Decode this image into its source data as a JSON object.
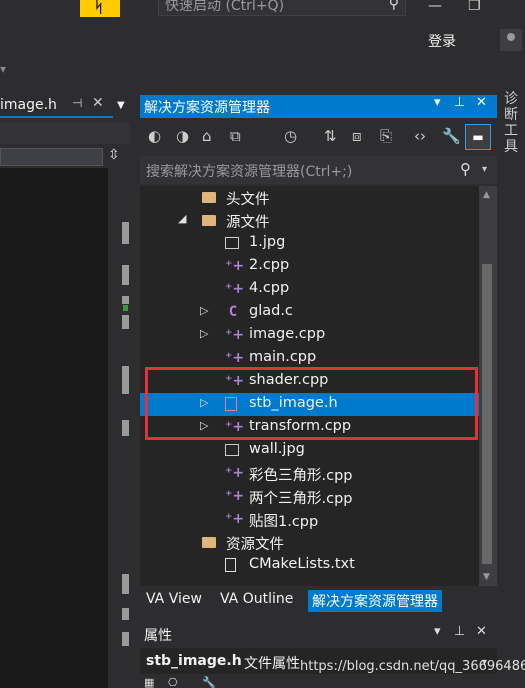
{
  "titlebar": {
    "logo_glyph": "ᛋ",
    "quick_launch_placeholder": "快速启动 (Ctrl+Q)",
    "search_glyph": "⚲",
    "minimize_glyph": "—",
    "restore_glyph": "❐",
    "login_label": "登录",
    "menu_overflow_glyph": "▾"
  },
  "editor": {
    "tab_title": "image.h",
    "tab_pin_glyph": "⊣",
    "tab_close_glyph": "✕",
    "tab_list_glyph": "▼",
    "split_glyph": "⇳"
  },
  "solution_explorer": {
    "title": "解决方案资源管理器",
    "title_buttons": [
      "▾",
      "⊥",
      "✕"
    ],
    "toolbar_icons": [
      "back-icon",
      "forward-icon",
      "home-icon",
      "switch-views-icon",
      "history-icon",
      "sync-icon",
      "collapse-icon",
      "copy-icon",
      "code-icon",
      "properties-icon",
      "preview-icon"
    ],
    "toolbar_glyphs": [
      "◐",
      "◑",
      "⌂",
      "⧉",
      "◷",
      "⇅",
      "⧈",
      "⎘",
      "‹›",
      "🔧"
    ],
    "toolbar_active_glyph": "▬",
    "search_placeholder": "搜索解决方案资源管理器(Ctrl+;)",
    "search_glyph": "⚲",
    "search_dd_glyph": "▾",
    "tree": [
      {
        "label": "头文件",
        "kind": "folder",
        "expander": ""
      },
      {
        "label": "源文件",
        "kind": "folder",
        "expander": "◢"
      },
      {
        "label": "1.jpg",
        "kind": "image",
        "expander": ""
      },
      {
        "label": "2.cpp",
        "kind": "cpp",
        "expander": ""
      },
      {
        "label": "4.cpp",
        "kind": "cpp",
        "expander": ""
      },
      {
        "label": "glad.c",
        "kind": "c",
        "expander": "▷"
      },
      {
        "label": "image.cpp",
        "kind": "cpp",
        "expander": "▷"
      },
      {
        "label": "main.cpp",
        "kind": "cpp",
        "expander": ""
      },
      {
        "label": "shader.cpp",
        "kind": "cpp",
        "expander": ""
      },
      {
        "label": "stb_image.h",
        "kind": "header",
        "expander": "▷",
        "selected": true
      },
      {
        "label": "transform.cpp",
        "kind": "cpp",
        "expander": "▷"
      },
      {
        "label": "wall.jpg",
        "kind": "image",
        "expander": ""
      },
      {
        "label": "彩色三角形.cpp",
        "kind": "cpp",
        "expander": ""
      },
      {
        "label": "两个三角形.cpp",
        "kind": "cpp",
        "expander": ""
      },
      {
        "label": "贴图1.cpp",
        "kind": "cpp",
        "expander": ""
      },
      {
        "label": "资源文件",
        "kind": "folder",
        "expander": ""
      },
      {
        "label": "CMakeLists.txt",
        "kind": "text",
        "expander": ""
      }
    ],
    "cpp_glyph": "⁺+",
    "c_glyph": "C",
    "scroll_up": "▲",
    "scroll_down": "▼"
  },
  "bottom_tabs": [
    "VA View",
    "VA Outline",
    "解决方案资源管理器"
  ],
  "properties": {
    "title": "属性",
    "title_buttons": [
      "▾",
      "⊥",
      "✕"
    ],
    "selected_name": "stb_image.h",
    "selected_kind": "文件属性",
    "dd_glyph": "▾",
    "toolbar_glyphs": [
      "▦",
      "⎔",
      "🔧"
    ]
  },
  "right_strip": {
    "label": "诊断工具"
  },
  "watermark": "https://blog.csdn.net/qq_36696486",
  "colors": {
    "accent": "#007acc",
    "highlight_box": "#e8303a",
    "background": "#2d2d30",
    "tree_bg": "#252526"
  }
}
